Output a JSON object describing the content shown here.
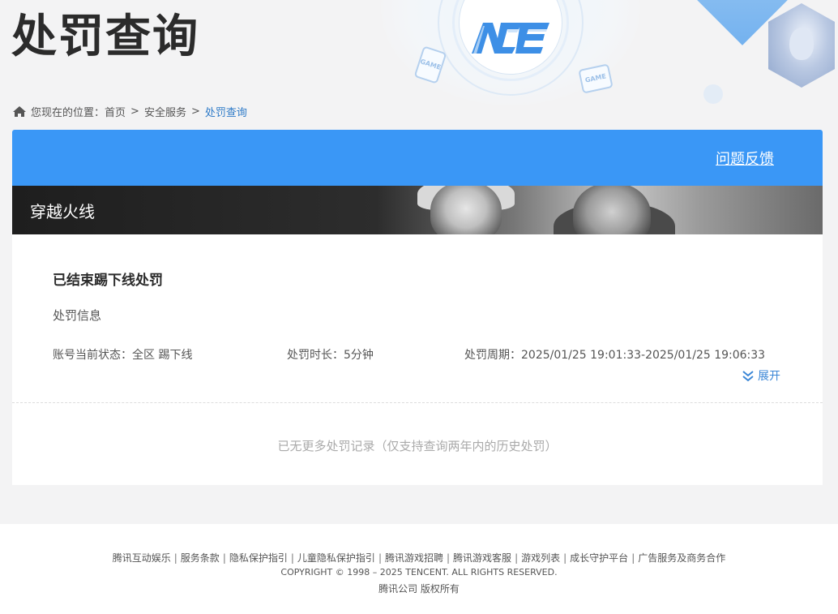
{
  "header": {
    "title": "处罚查询",
    "logo_text": "ACE",
    "card_left_text": "GAME",
    "card_right_text": "GAME"
  },
  "breadcrumb": {
    "prefix": "您现在的位置：",
    "items": [
      "首页",
      "安全服务",
      "处罚查询"
    ],
    "separator": ">"
  },
  "topbar": {
    "feedback_label": "问题反馈",
    "color": "#3a97f6"
  },
  "game": {
    "name": "穿越火线"
  },
  "punishment": {
    "title": "已结束踢下线处罚",
    "section_label": "处罚信息",
    "status": "账号当前状态：全区 踢下线",
    "duration": "处罚时长：5分钟",
    "period": "处罚周期：2025/01/25 19:01:33-2025/01/25 19:06:33",
    "expand_label": "展开",
    "no_more_text": "已无更多处罚记录（仅支持查询两年内的历史处罚）"
  },
  "footer": {
    "links": [
      "腾讯互动娱乐",
      "服务条款",
      "隐私保护指引",
      "儿童隐私保护指引",
      "腾讯游戏招聘",
      "腾讯游戏客服",
      "游戏列表",
      "成长守护平台",
      "广告服务及商务合作"
    ],
    "copyright": "COPYRIGHT © 1998 – 2025 TENCENT. ALL RIGHTS RESERVED.",
    "company": "腾讯公司 版权所有"
  },
  "icons": {
    "home": "home-icon",
    "expand": "chevron-down-icon"
  }
}
